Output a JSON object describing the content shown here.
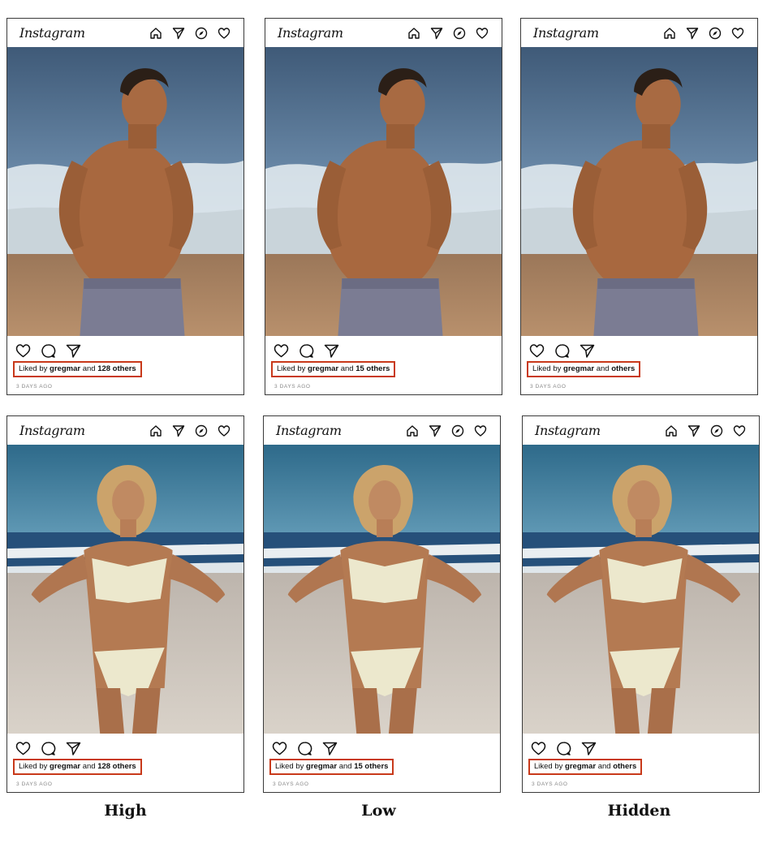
{
  "app_name": "Instagram",
  "nav_icons": [
    "home-icon",
    "send-icon",
    "explore-icon",
    "heart-icon"
  ],
  "action_icons": [
    "like-icon",
    "comment-icon",
    "share-icon"
  ],
  "accent_color": "#c8391a",
  "conditions": [
    {
      "caption": "High",
      "liked_prefix": "Liked by",
      "liked_user": "gregmar",
      "liked_and": "and",
      "liked_count": "128 others",
      "time_ago": "3 DAYS AGO"
    },
    {
      "caption": "Low",
      "liked_prefix": "Liked by",
      "liked_user": "gregmar",
      "liked_and": "and",
      "liked_count": "15 others",
      "time_ago": "3 DAYS AGO"
    },
    {
      "caption": "Hidden",
      "liked_prefix": "Liked by",
      "liked_user": "gregmar",
      "liked_and": "and",
      "liked_count": "others",
      "time_ago": "3 DAYS AGO"
    }
  ],
  "posts": [
    {
      "photo": "man-on-beach-photo"
    },
    {
      "photo": "woman-on-beach-photo"
    }
  ]
}
